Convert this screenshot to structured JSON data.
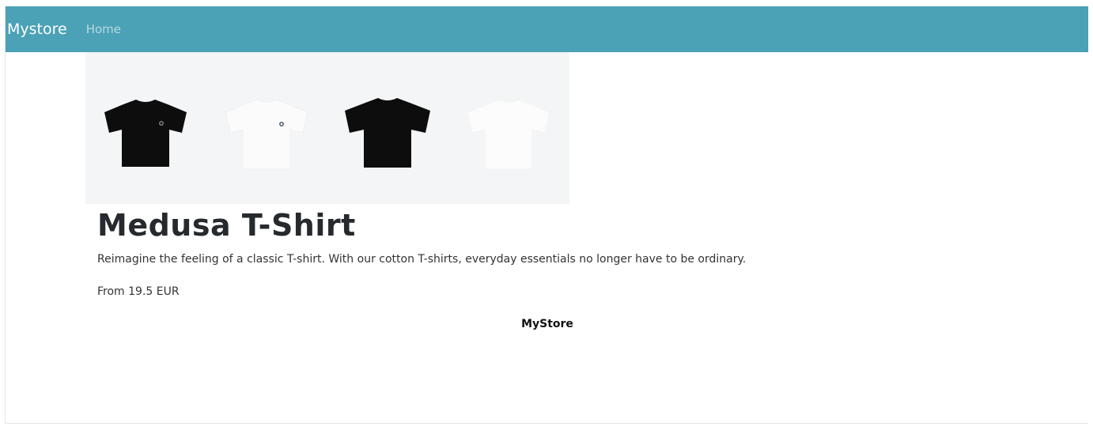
{
  "navbar": {
    "brand": "Mystore",
    "links": [
      {
        "label": "Home"
      }
    ],
    "color": "#4ba1b5"
  },
  "product": {
    "title": "Medusa T-Shirt",
    "description": "Reimagine the feeling of a classic T-shirt. With our cotton T-shirts, everyday essentials no longer have to be ordinary.",
    "price": "From 19.5 EUR",
    "images": [
      {
        "icon": "black-tshirt-image"
      },
      {
        "icon": "white-tshirt-image"
      },
      {
        "icon": "black-tshirt-image"
      },
      {
        "icon": "white-tshirt-image"
      }
    ]
  },
  "footer": {
    "text": "MyStore"
  }
}
